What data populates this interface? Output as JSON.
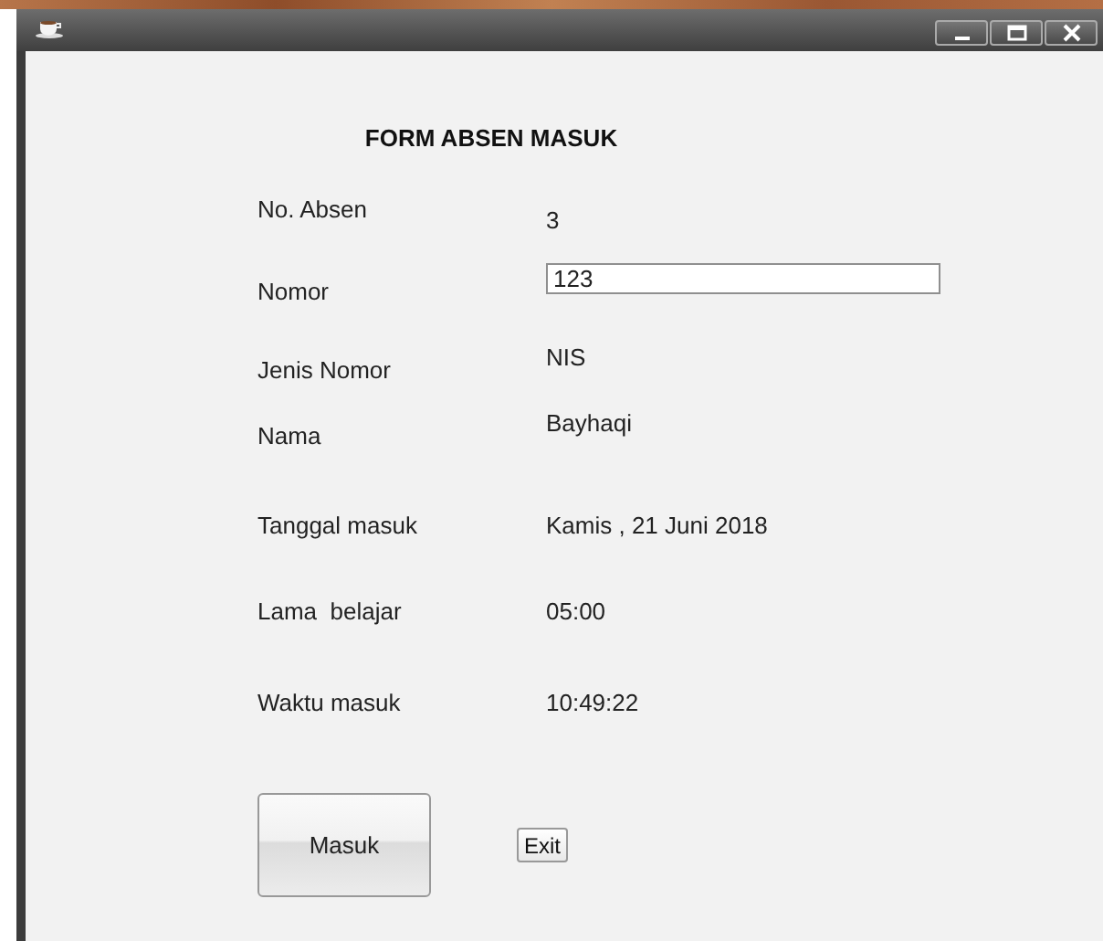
{
  "window": {
    "title_buttons": [
      {
        "kind": "minimize"
      },
      {
        "kind": "maximize"
      },
      {
        "kind": "close"
      }
    ]
  },
  "form": {
    "title": "FORM ABSEN MASUK",
    "fields": [
      {
        "label": "No. Absen",
        "kind": "text",
        "value": "3"
      },
      {
        "label": "Nomor",
        "kind": "input",
        "value": "123"
      },
      {
        "label": "Jenis Nomor",
        "kind": "text",
        "value": "NIS"
      },
      {
        "label": "Nama",
        "kind": "text",
        "value": "Bayhaqi"
      },
      {
        "label": "Tanggal masuk",
        "kind": "text",
        "value": "Kamis , 21 Juni 2018"
      },
      {
        "label": "Lama  belajar",
        "kind": "text",
        "value": "05:00"
      },
      {
        "label": "Waktu masuk",
        "kind": "text",
        "value": "10:49:22"
      }
    ],
    "buttons": [
      {
        "label": "Masuk",
        "kind": "large"
      },
      {
        "label": "Exit",
        "kind": "small"
      }
    ]
  }
}
